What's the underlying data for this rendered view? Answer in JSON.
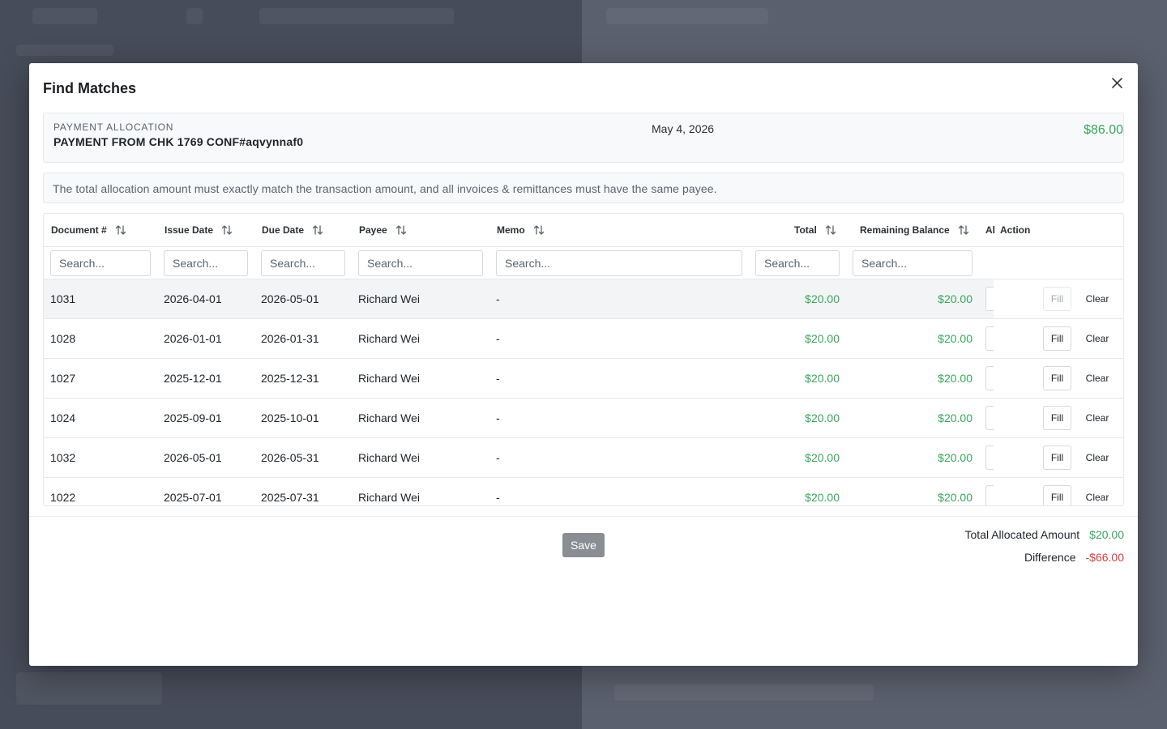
{
  "modal": {
    "title": "Find Matches",
    "close_icon": "close-icon"
  },
  "allocation": {
    "label": "PAYMENT ALLOCATION",
    "description": "PAYMENT FROM CHK 1769 CONF#aqvynnaf0",
    "date": "May 4, 2026",
    "amount": "$86.00"
  },
  "notice": "The total allocation amount must exactly match the transaction amount, and all invoices & remittances must have the same payee.",
  "table": {
    "headers": {
      "document": "Document #",
      "issue_date": "Issue Date",
      "due_date": "Due Date",
      "payee": "Payee",
      "memo": "Memo",
      "total": "Total",
      "remaining": "Remaining Balance",
      "allocated_truncated": "Al",
      "action": "Action"
    },
    "search_placeholder": "Search...",
    "rows": [
      {
        "document": "1031",
        "issue_date": "2026-04-01",
        "due_date": "2026-05-01",
        "payee": "Richard Wei",
        "memo": "-",
        "total": "$20.00",
        "remaining": "$20.00",
        "fill": "Fill",
        "clear": "Clear"
      },
      {
        "document": "1028",
        "issue_date": "2026-01-01",
        "due_date": "2026-01-31",
        "payee": "Richard Wei",
        "memo": "-",
        "total": "$20.00",
        "remaining": "$20.00",
        "fill": "Fill",
        "clear": "Clear"
      },
      {
        "document": "1027",
        "issue_date": "2025-12-01",
        "due_date": "2025-12-31",
        "payee": "Richard Wei",
        "memo": "-",
        "total": "$20.00",
        "remaining": "$20.00",
        "fill": "Fill",
        "clear": "Clear"
      },
      {
        "document": "1024",
        "issue_date": "2025-09-01",
        "due_date": "2025-10-01",
        "payee": "Richard Wei",
        "memo": "-",
        "total": "$20.00",
        "remaining": "$20.00",
        "fill": "Fill",
        "clear": "Clear"
      },
      {
        "document": "1032",
        "issue_date": "2026-05-01",
        "due_date": "2026-05-31",
        "payee": "Richard Wei",
        "memo": "-",
        "total": "$20.00",
        "remaining": "$20.00",
        "fill": "Fill",
        "clear": "Clear"
      },
      {
        "document": "1022",
        "issue_date": "2025-07-01",
        "due_date": "2025-07-31",
        "payee": "Richard Wei",
        "memo": "-",
        "total": "$20.00",
        "remaining": "$20.00",
        "fill": "Fill",
        "clear": "Clear"
      }
    ]
  },
  "footer": {
    "save_label": "Save",
    "total_allocated_label": "Total Allocated Amount",
    "total_allocated_value": "$20.00",
    "difference_label": "Difference",
    "difference_value": "-$66.00"
  },
  "colors": {
    "positive": "#3aa65c",
    "negative": "#d8403f",
    "overlay": "#4b5160"
  }
}
